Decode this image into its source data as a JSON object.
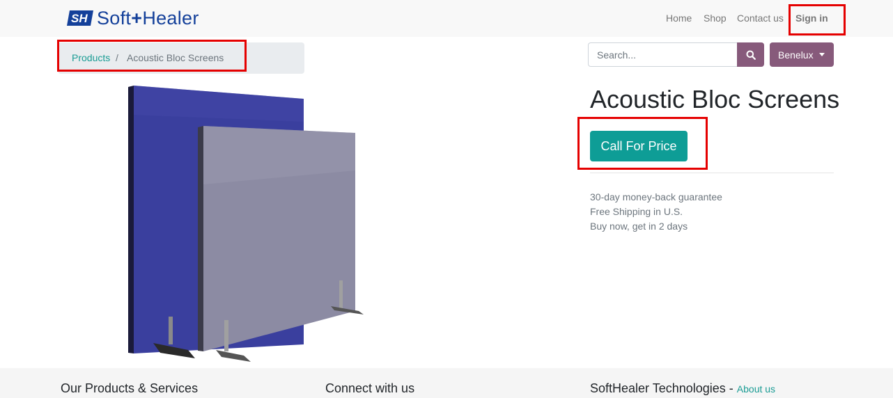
{
  "brand": {
    "logo_text_prefix": "Soft",
    "logo_text_suffix": "Healer",
    "color": "#14409a"
  },
  "nav": {
    "home": "Home",
    "shop": "Shop",
    "contact": "Contact us",
    "signin": "Sign in"
  },
  "breadcrumb": {
    "parent": "Products",
    "separator": "/",
    "current": "Acoustic Bloc Screens"
  },
  "search": {
    "placeholder": "Search..."
  },
  "language": {
    "selected": "Benelux"
  },
  "product": {
    "title": "Acoustic Bloc Screens",
    "cta_label": "Call For Price",
    "perks": [
      "30-day money-back guarantee",
      "Free Shipping in U.S.",
      "Buy now, get in 2 days"
    ]
  },
  "footer": {
    "col1": "Our Products & Services",
    "col2": "Connect with us",
    "col3": "SoftHealer Technologies",
    "col3_sep": " - ",
    "col3_link": "About us"
  },
  "colors": {
    "accent_teal": "#0e9d96",
    "accent_purple": "#875a7b",
    "highlight_red": "#e50000"
  }
}
